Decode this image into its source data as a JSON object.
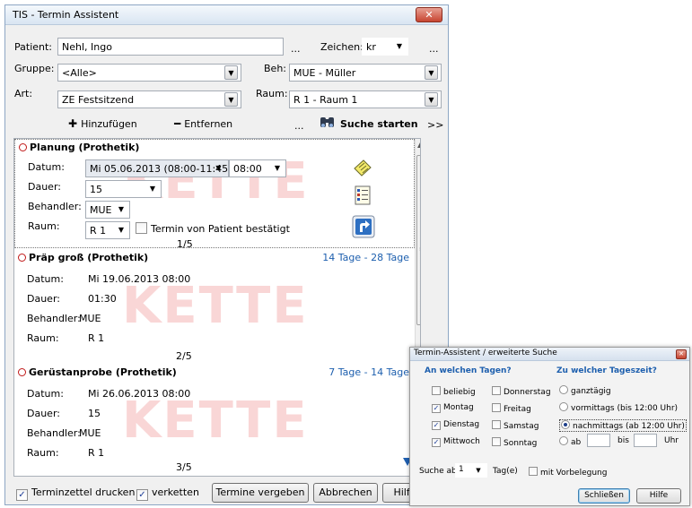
{
  "window": {
    "title": "TIS - Termin Assistent",
    "close_glyph": "✕"
  },
  "header": {
    "patient_label": "Patient:",
    "patient_value": "Nehl, Ingo",
    "patient_more": "...",
    "zeichen_label": "Zeichen:",
    "zeichen_value": "kr",
    "zeichen_more": "...",
    "gruppe_label": "Gruppe:",
    "gruppe_value": "<Alle>",
    "beh_label": "Beh:",
    "beh_value": "MUE - Müller",
    "art_label": "Art:",
    "art_value": "ZE Festsitzend",
    "raum_label": "Raum:",
    "raum_value": "R 1 - Raum 1"
  },
  "toolbar": {
    "add_label": "Hinzufügen",
    "remove_label": "Entfernen",
    "more": "...",
    "search_label": "Suche starten",
    "expand": ">>"
  },
  "appointments": [
    {
      "title": "Planung (Prothetik)",
      "datum_label": "Datum:",
      "datum_value": "Mi 05.06.2013 (08:00-11:45)",
      "time_value": "08:00",
      "dauer_label": "Dauer:",
      "dauer_value": "15",
      "behandler_label": "Behandler:",
      "behandler_value": "MUE",
      "raum_label": "Raum:",
      "raum_value": "R 1",
      "confirm_label": "Termin von Patient bestätigt",
      "counter": "1/5",
      "watermark": "KETTE"
    },
    {
      "title": "Präp groß (Prothetik)",
      "range": "14 Tage - 28 Tage",
      "datum_label": "Datum:",
      "datum_value": "Mi 19.06.2013  08:00",
      "dauer_label": "Dauer:",
      "dauer_value": "01:30",
      "behandler_label": "Behandler:",
      "behandler_value": "MUE",
      "raum_label": "Raum:",
      "raum_value": "R 1",
      "counter": "2/5",
      "watermark": "KETTE"
    },
    {
      "title": "Gerüstanprobe (Prothetik)",
      "range": "7 Tage - 14 Tage",
      "datum_label": "Datum:",
      "datum_value": "Mi 26.06.2013  08:00",
      "dauer_label": "Dauer:",
      "dauer_value": "15",
      "behandler_label": "Behandler:",
      "behandler_value": "MUE",
      "raum_label": "Raum:",
      "raum_value": "R 1",
      "counter": "3/5",
      "watermark": "KETTE"
    }
  ],
  "footer": {
    "print_label": "Terminzettel drucken",
    "print_checked": true,
    "chain_label": "verketten",
    "chain_checked": true,
    "assign_label": "Termine vergeben",
    "cancel_label": "Abbrechen",
    "help_label": "Hilfe"
  },
  "dialog": {
    "title": "Termin-Assistent / erweiterte Suche",
    "days_heading": "An welchen Tagen?",
    "time_heading": "Zu welcher Tageszeit?",
    "days": [
      {
        "label": "beliebig",
        "checked": false
      },
      {
        "label": "Montag",
        "checked": true
      },
      {
        "label": "Dienstag",
        "checked": true
      },
      {
        "label": "Mittwoch",
        "checked": true
      },
      {
        "label": "Donnerstag",
        "checked": false
      },
      {
        "label": "Freitag",
        "checked": false
      },
      {
        "label": "Samstag",
        "checked": false
      },
      {
        "label": "Sonntag",
        "checked": false
      }
    ],
    "times": [
      {
        "label": "ganztägig",
        "selected": false
      },
      {
        "label": "vormittags  (bis 12:00 Uhr)",
        "selected": false
      },
      {
        "label": "nachmittags (ab 12:00 Uhr)",
        "selected": true
      }
    ],
    "ab_label": "ab",
    "bis_label": "bis",
    "uhr_label": "Uhr",
    "suche_ab_label": "Suche ab",
    "suche_ab_value": "1",
    "tage_label": "Tag(e)",
    "vorbelegung_label": "mit Vorbelegung",
    "close_label": "Schließen",
    "help_label": "Hilfe"
  },
  "colors": {
    "accent_blue": "#1d5fae",
    "watermark_red": "#f7c9c9",
    "ring_red": "#c01818"
  }
}
